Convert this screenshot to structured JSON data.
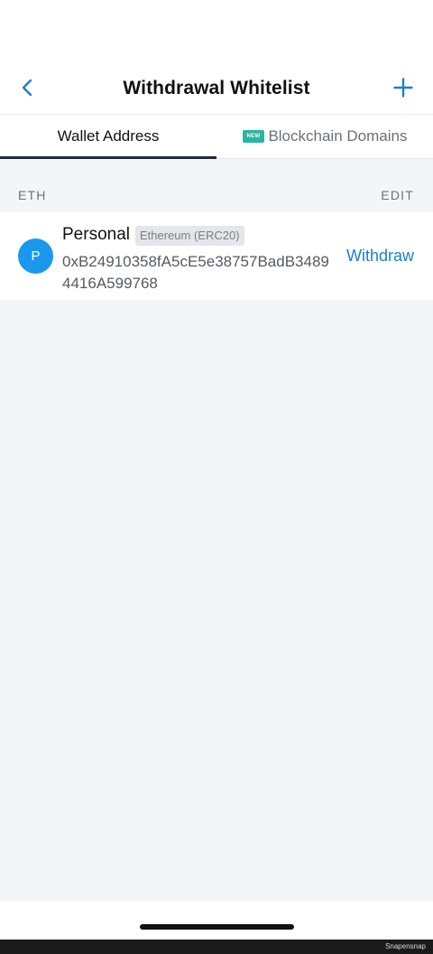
{
  "header": {
    "title": "Withdrawal Whitelist",
    "back_icon": "chevron-left-icon",
    "add_icon": "plus-icon",
    "accent_color": "#1a7fcf"
  },
  "tabs": [
    {
      "label": "Wallet Address",
      "active": true
    },
    {
      "label": "Blockchain Domains",
      "active": false,
      "badge": "NEW",
      "badge_color": "#2bb5a0"
    }
  ],
  "section": {
    "label": "ETH",
    "edit_label": "EDIT"
  },
  "addresses": [
    {
      "avatar_letter": "P",
      "avatar_color": "#1a98ee",
      "name": "Personal",
      "network": "Ethereum (ERC20)",
      "address": "0xB24910358fA5cE5e38757BadB34894416A599768",
      "action_label": "Withdraw"
    }
  ],
  "watermark": "Snapensnap"
}
